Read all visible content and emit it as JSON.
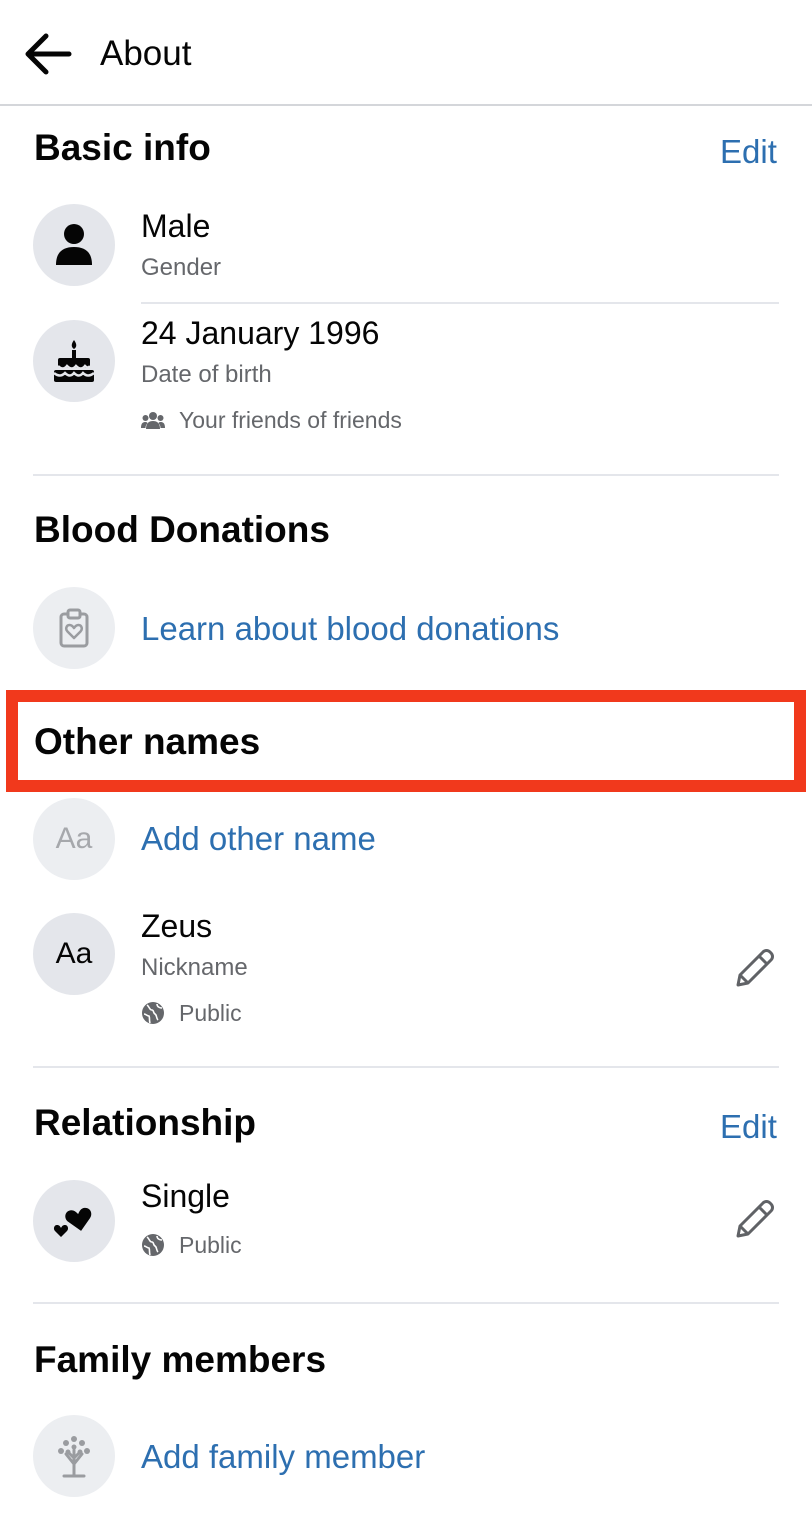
{
  "header": {
    "title": "About"
  },
  "basic_info": {
    "title": "Basic info",
    "edit_label": "Edit",
    "gender": {
      "value": "Male",
      "label": "Gender"
    },
    "birth": {
      "value": "24 January 1996",
      "label": "Date of birth",
      "privacy": "Your friends of friends"
    }
  },
  "blood": {
    "title": "Blood Donations",
    "link": "Learn about blood donations"
  },
  "other_names": {
    "title": "Other names",
    "add_link": "Add other name",
    "add_icon_text": "Aa",
    "nickname": {
      "icon_text": "Aa",
      "value": "Zeus",
      "label": "Nickname",
      "privacy": "Public"
    }
  },
  "relationship": {
    "title": "Relationship",
    "edit_label": "Edit",
    "status": {
      "value": "Single",
      "privacy": "Public"
    }
  },
  "family": {
    "title": "Family members",
    "add_link": "Add family member"
  },
  "colors": {
    "link": "#2d6fb0",
    "highlight": "#f1391c",
    "icon_bg": "#e4e6eb",
    "secondary_text": "#65676b"
  }
}
